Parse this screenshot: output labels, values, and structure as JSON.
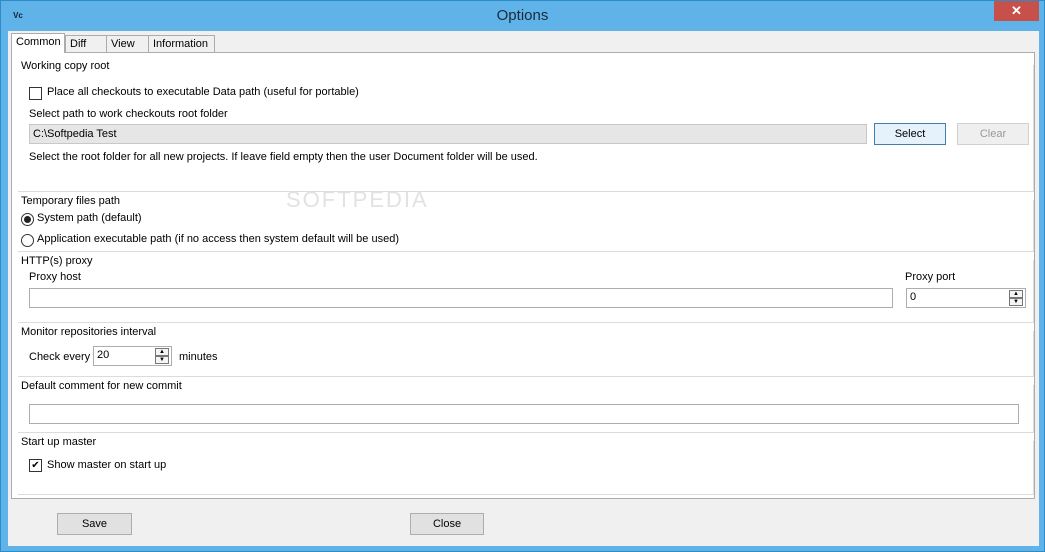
{
  "window": {
    "title": "Options",
    "icon_text": "Vc",
    "close_glyph": "✕"
  },
  "tabs": [
    {
      "label": "Common"
    },
    {
      "label": "Diff"
    },
    {
      "label": "View"
    },
    {
      "label": "Information"
    }
  ],
  "working_copy": {
    "caption": "Working copy root",
    "checkbox_label": "Place all checkouts to executable Data path (useful for portable)",
    "checkbox_checked": false,
    "path_label": "Select path to work checkouts root folder",
    "path_value": "C:\\Softpedia Test",
    "select_label": "Select",
    "clear_label": "Clear",
    "hint": "Select the root folder for all new projects. If leave field empty then the user Document folder will be used.",
    "watermark": "SOFTPEDIA"
  },
  "temp_path": {
    "caption": "Temporary files path",
    "options": [
      {
        "label": "System path (default)",
        "selected": true
      },
      {
        "label": "Application executable path (if no access then system default will be used)",
        "selected": false
      }
    ]
  },
  "proxy": {
    "caption": "HTTP(s) proxy",
    "host_label": "Proxy host",
    "host_value": "",
    "port_label": "Proxy port",
    "port_value": "0"
  },
  "monitor": {
    "caption": "Monitor repositories interval",
    "check_every_label": "Check every",
    "interval_value": "20",
    "minutes_label": "minutes"
  },
  "comment": {
    "caption": "Default comment for new commit",
    "value": ""
  },
  "startup": {
    "caption": "Start up master",
    "checkbox_label": "Show master on start up",
    "checkbox_checked": true,
    "check_glyph": "✔"
  },
  "footer": {
    "save_label": "Save",
    "close_label": "Close"
  },
  "spin": {
    "up_glyph": "▲",
    "down_glyph": "▼"
  }
}
